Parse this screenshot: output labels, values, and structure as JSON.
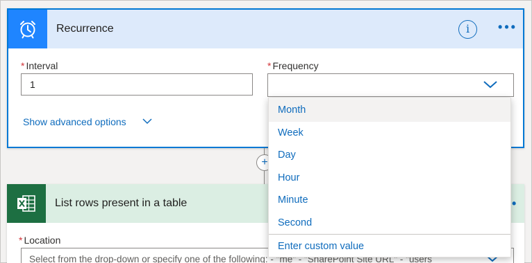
{
  "recurrence": {
    "title": "Recurrence",
    "info_symbol": "i",
    "more_symbol": "•••",
    "interval": {
      "required_marker": "*",
      "label": "Interval",
      "value": "1"
    },
    "frequency": {
      "required_marker": "*",
      "label": "Frequency",
      "value": ""
    },
    "advanced_link": "Show advanced options"
  },
  "connector": {
    "add_symbol": "+"
  },
  "list_rows": {
    "title": "List rows present in a table",
    "more_symbol": "•",
    "location": {
      "required_marker": "*",
      "label": "Location",
      "placeholder": "Select from the drop-down or specify one of the following: - \"me\" - \"SharePoint Site URL\" - \"users"
    }
  },
  "frequency_menu": {
    "options": [
      "Month",
      "Week",
      "Day",
      "Hour",
      "Minute",
      "Second"
    ],
    "highlighted": "Month",
    "custom_value": "Enter custom value"
  },
  "colors": {
    "accent": "#0078d4",
    "recurrence_icon_bg": "#1f85ff",
    "excel_icon_bg": "#1d6f42",
    "required": "#d13438"
  },
  "icons": {
    "recurrence": "alarm-clock-icon",
    "excel": "excel-icon",
    "info": "info-icon",
    "more": "more-icon",
    "chevron": "chevron-down-icon"
  }
}
